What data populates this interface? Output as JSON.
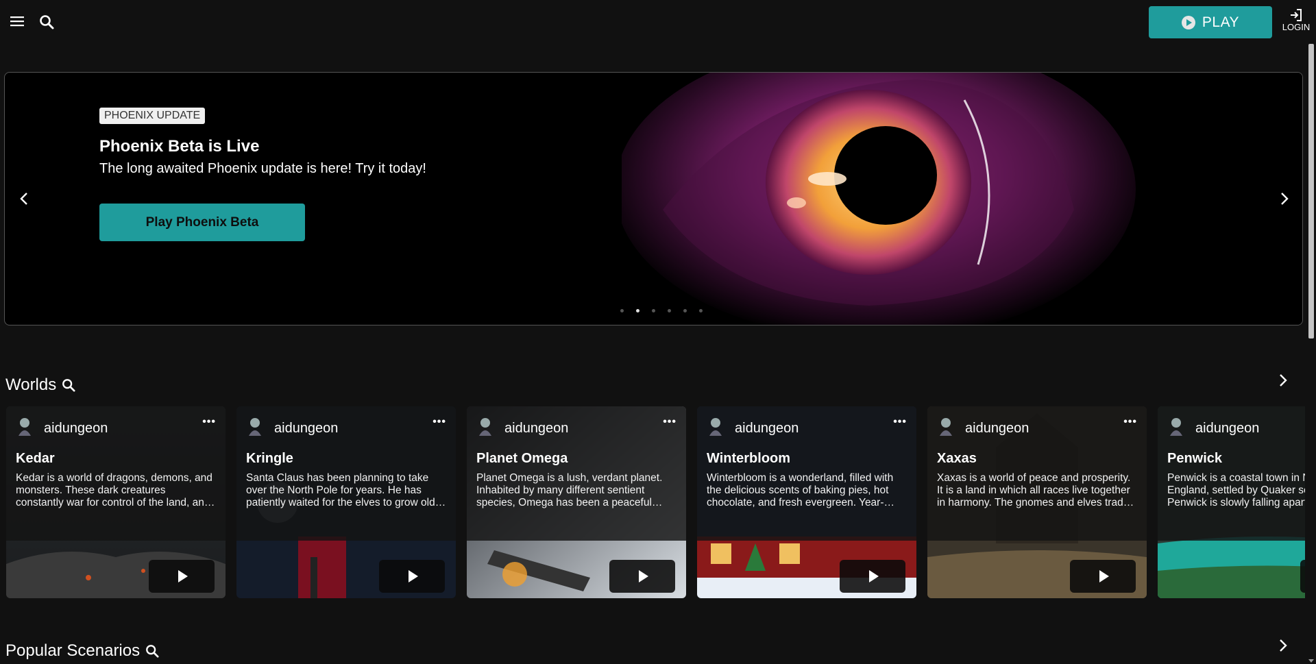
{
  "topbar": {
    "menu_icon": "hamburger-icon",
    "search_icon": "search-icon",
    "play_label": "PLAY",
    "login_label": "LOGIN"
  },
  "hero": {
    "badge": "PHOENIX UPDATE",
    "title": "Phoenix Beta is Live",
    "subtitle": "The long awaited Phoenix update is here! Try it today!",
    "cta_label": "Play Phoenix Beta",
    "slide_count": 6,
    "active_slide": 2
  },
  "worlds": {
    "heading": "Worlds",
    "cards": [
      {
        "author": "aidungeon",
        "title": "Kedar",
        "description": "Kedar is a world of dragons, demons, and monsters. These dark creatures constantly war for control of the land, and the humans who live there."
      },
      {
        "author": "aidungeon",
        "title": "Kringle",
        "description": "Santa Claus has been planning to take over the North Pole for years. He has patiently waited for the elves to grow old and weak."
      },
      {
        "author": "aidungeon",
        "title": "Planet Omega",
        "description": "Planet Omega is a lush, verdant planet. Inhabited by many different sentient species, Omega has been a peaceful world for centuries."
      },
      {
        "author": "aidungeon",
        "title": "Winterbloom",
        "description": "Winterbloom is a wonderland, filled with the delicious scents of baking pies, hot chocolate, and fresh evergreen. Year-round snow falls gently."
      },
      {
        "author": "aidungeon",
        "title": "Xaxas",
        "description": "Xaxas is a world of peace and prosperity. It is a land in which all races live together in harmony. The gnomes and elves trade freely."
      },
      {
        "author": "aidungeon",
        "title": "Penwick",
        "description": "Penwick is a coastal town in New England, settled by Quaker settlers. Penwick is slowly falling apart."
      }
    ]
  },
  "popular": {
    "heading": "Popular Scenarios"
  },
  "colors": {
    "accent": "#1f9c9c",
    "background": "#111111"
  }
}
